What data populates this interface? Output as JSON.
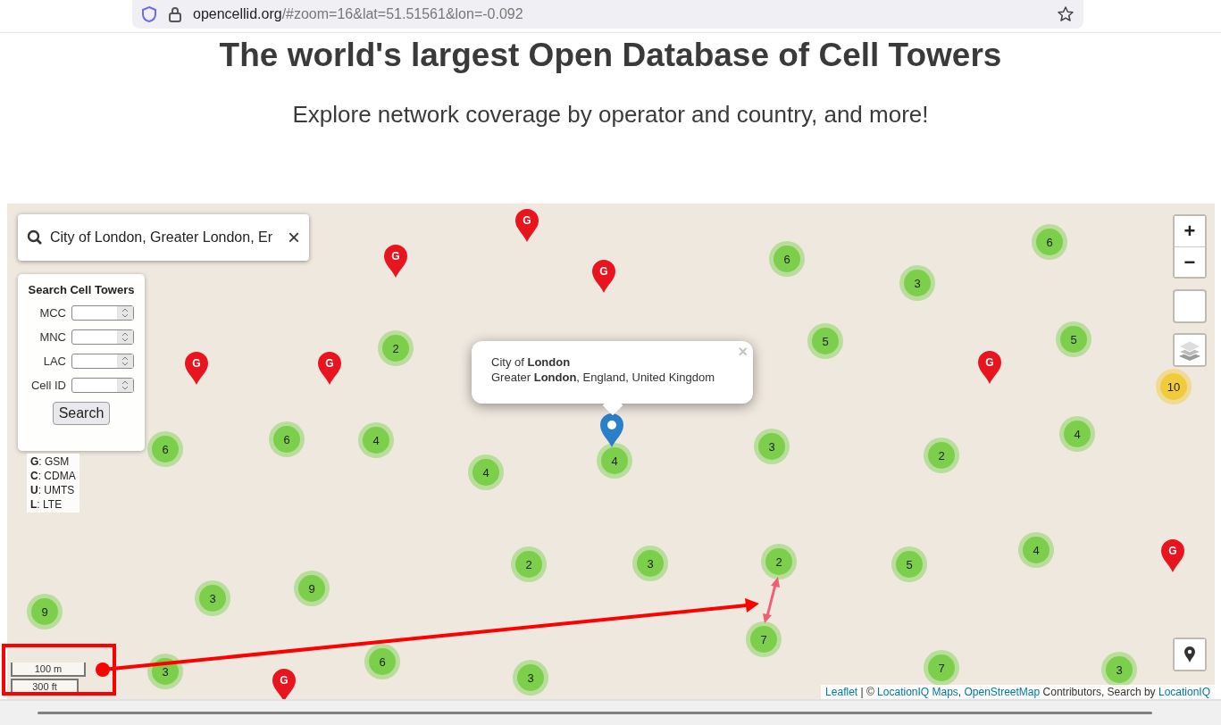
{
  "browser": {
    "url_host": "opencellid.org",
    "url_rest": "/#zoom=16&lat=51.51561&lon=-0.092"
  },
  "heading": "The world's largest Open Database of Cell Towers",
  "subtitle": "Explore network coverage by operator and country, and more!",
  "map": {
    "search": {
      "value": "City of London, Greater London, Er",
      "clear": "×"
    },
    "panel": {
      "title": "Search Cell Towers",
      "fields": [
        {
          "label": "MCC"
        },
        {
          "label": "MNC"
        },
        {
          "label": "LAC"
        },
        {
          "label": "Cell ID"
        }
      ],
      "button": "Search"
    },
    "legend": [
      "**G**: GSM",
      "**C**: CDMA",
      "**U**: UMTS",
      "**L**: LTE"
    ],
    "popup": {
      "lines": [
        "City of **London**",
        "Greater **London**, England, United Kingdom"
      ],
      "close": "×"
    },
    "zoom": {
      "in": "+",
      "out": "−"
    },
    "scale": [
      "100 m",
      "300 ft"
    ],
    "attribution": [
      {
        "kind": "link",
        "text": "Leaflet"
      },
      {
        "kind": "text",
        "text": " | © "
      },
      {
        "kind": "link",
        "text": "LocationIQ Maps"
      },
      {
        "kind": "text",
        "text": ", "
      },
      {
        "kind": "link",
        "text": "OpenStreetMap"
      },
      {
        "kind": "text",
        "text": " Contributors, Search by "
      },
      {
        "kind": "link",
        "text": "LocationIQ"
      }
    ],
    "clusters": [
      {
        "count": "6",
        "color": "#7ccf4a"
      },
      {
        "count": "6",
        "color": "#7ccf4a"
      },
      {
        "count": "3",
        "color": "#7ccf4a"
      },
      {
        "count": "2",
        "color": "#7ccf4a"
      },
      {
        "count": "5",
        "color": "#7ccf4a"
      },
      {
        "count": "5",
        "color": "#7ccf4a"
      },
      {
        "count": "10",
        "color": "#f0cc3c"
      },
      {
        "count": "6",
        "color": "#7ccf4a"
      },
      {
        "count": "6",
        "color": "#7ccf4a"
      },
      {
        "count": "4",
        "color": "#7ccf4a"
      },
      {
        "count": "4",
        "color": "#7ccf4a"
      },
      {
        "count": "4",
        "color": "#7ccf4a"
      },
      {
        "count": "3",
        "color": "#7ccf4a"
      },
      {
        "count": "2",
        "color": "#7ccf4a"
      },
      {
        "count": "4",
        "color": "#7ccf4a"
      },
      {
        "count": "2",
        "color": "#7ccf4a"
      },
      {
        "count": "3",
        "color": "#7ccf4a"
      },
      {
        "count": "2",
        "color": "#7ccf4a"
      },
      {
        "count": "5",
        "color": "#7ccf4a"
      },
      {
        "count": "4",
        "color": "#7ccf4a"
      },
      {
        "count": "3",
        "color": "#7ccf4a"
      },
      {
        "count": "9",
        "color": "#7ccf4a"
      },
      {
        "count": "9",
        "color": "#7ccf4a"
      },
      {
        "count": "7",
        "color": "#7ccf4a"
      },
      {
        "count": "3",
        "color": "#7ccf4a"
      },
      {
        "count": "6",
        "color": "#7ccf4a"
      },
      {
        "count": "3",
        "color": "#7ccf4a"
      },
      {
        "count": "7",
        "color": "#7ccf4a"
      },
      {
        "count": "3",
        "color": "#7ccf4a"
      }
    ],
    "markers": [
      {
        "label": "G"
      },
      {
        "label": "G"
      },
      {
        "label": "G"
      },
      {
        "label": "G"
      },
      {
        "label": "G"
      },
      {
        "label": "G"
      },
      {
        "label": "G"
      },
      {
        "label": "G"
      }
    ]
  }
}
